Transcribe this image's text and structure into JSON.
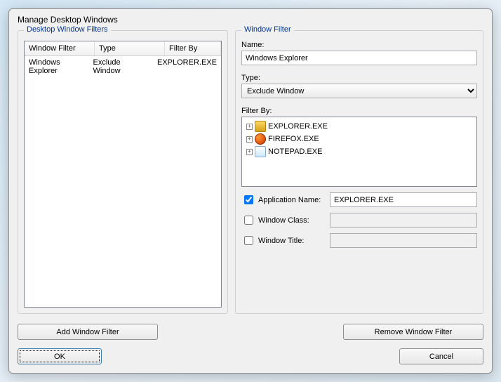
{
  "dialog": {
    "title": "Manage Desktop Windows"
  },
  "leftGroup": {
    "title": "Desktop Window Filters",
    "columns": [
      "Window Filter",
      "Type",
      "Filter By"
    ],
    "rows": [
      {
        "filter": "Windows Explorer",
        "type": "Exclude Window",
        "by": "EXPLORER.EXE"
      }
    ]
  },
  "rightGroup": {
    "title": "Window Filter",
    "nameLabel": "Name:",
    "nameValue": "Windows Explorer",
    "typeLabel": "Type:",
    "typeValue": "Exclude Window",
    "filterByLabel": "Filter By:",
    "treeItems": [
      {
        "label": "EXPLORER.EXE",
        "iconClass": "icon-explorer"
      },
      {
        "label": "FIREFOX.EXE",
        "iconClass": "icon-firefox"
      },
      {
        "label": "NOTEPAD.EXE",
        "iconClass": "icon-notepad"
      }
    ],
    "appNameLabel": "Application Name:",
    "appNameChecked": true,
    "appNameValue": "EXPLORER.EXE",
    "windowClassLabel": "Window Class:",
    "windowClassChecked": false,
    "windowClassValue": "",
    "windowTitleLabel": "Window Title:",
    "windowTitleChecked": false,
    "windowTitleValue": ""
  },
  "buttons": {
    "addFilter": "Add Window Filter",
    "removeFilter": "Remove Window Filter",
    "ok": "OK",
    "cancel": "Cancel"
  }
}
